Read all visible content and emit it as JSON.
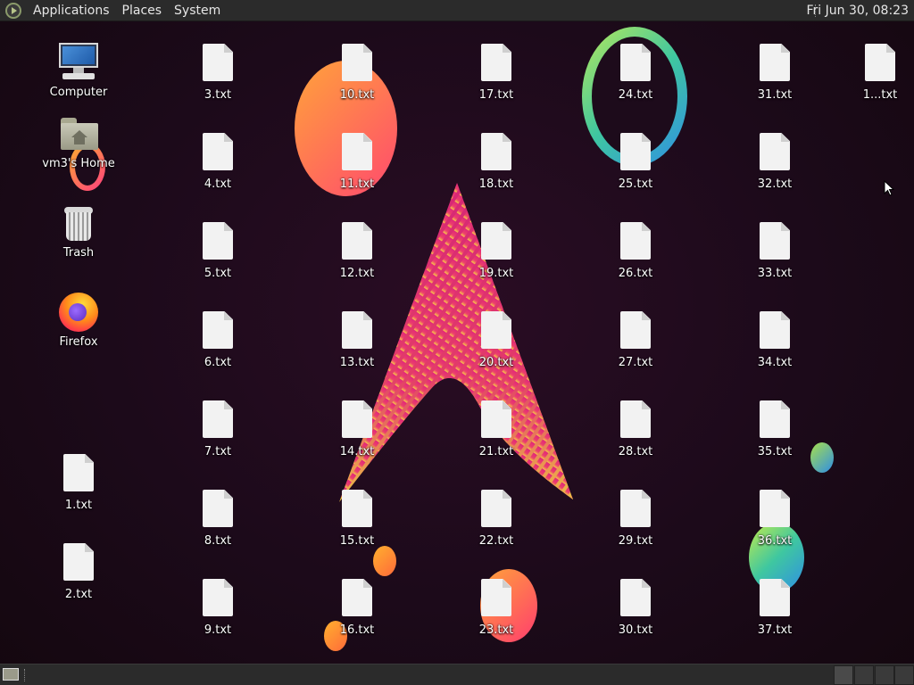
{
  "top_panel": {
    "menus": [
      "Applications",
      "Places",
      "System"
    ],
    "clock": "Fri Jun 30, 08:23"
  },
  "desktop": {
    "system_icons": [
      {
        "label": "Computer",
        "icon": "computer-icon"
      },
      {
        "label": "vm3's Home",
        "icon": "home-folder-icon"
      },
      {
        "label": "Trash",
        "icon": "trash-icon"
      },
      {
        "label": "Firefox",
        "icon": "firefox-icon"
      }
    ],
    "files": [
      "1.txt",
      "2.txt",
      "3.txt",
      "4.txt",
      "5.txt",
      "6.txt",
      "7.txt",
      "8.txt",
      "9.txt",
      "10.txt",
      "11.txt",
      "12.txt",
      "13.txt",
      "14.txt",
      "15.txt",
      "16.txt",
      "17.txt",
      "18.txt",
      "19.txt",
      "20.txt",
      "21.txt",
      "22.txt",
      "23.txt",
      "24.txt",
      "25.txt",
      "26.txt",
      "27.txt",
      "28.txt",
      "29.txt",
      "30.txt",
      "31.txt",
      "32.txt",
      "33.txt",
      "34.txt",
      "35.txt",
      "36.txt",
      "37.txt"
    ],
    "overlapped_file_label": "1...txt"
  },
  "colors": {
    "panel": "#2b2b2b",
    "wallpaper": "#1c0a1a",
    "arch_logo_top": "#e0287a",
    "arch_logo_bottom": "#f7c948"
  }
}
